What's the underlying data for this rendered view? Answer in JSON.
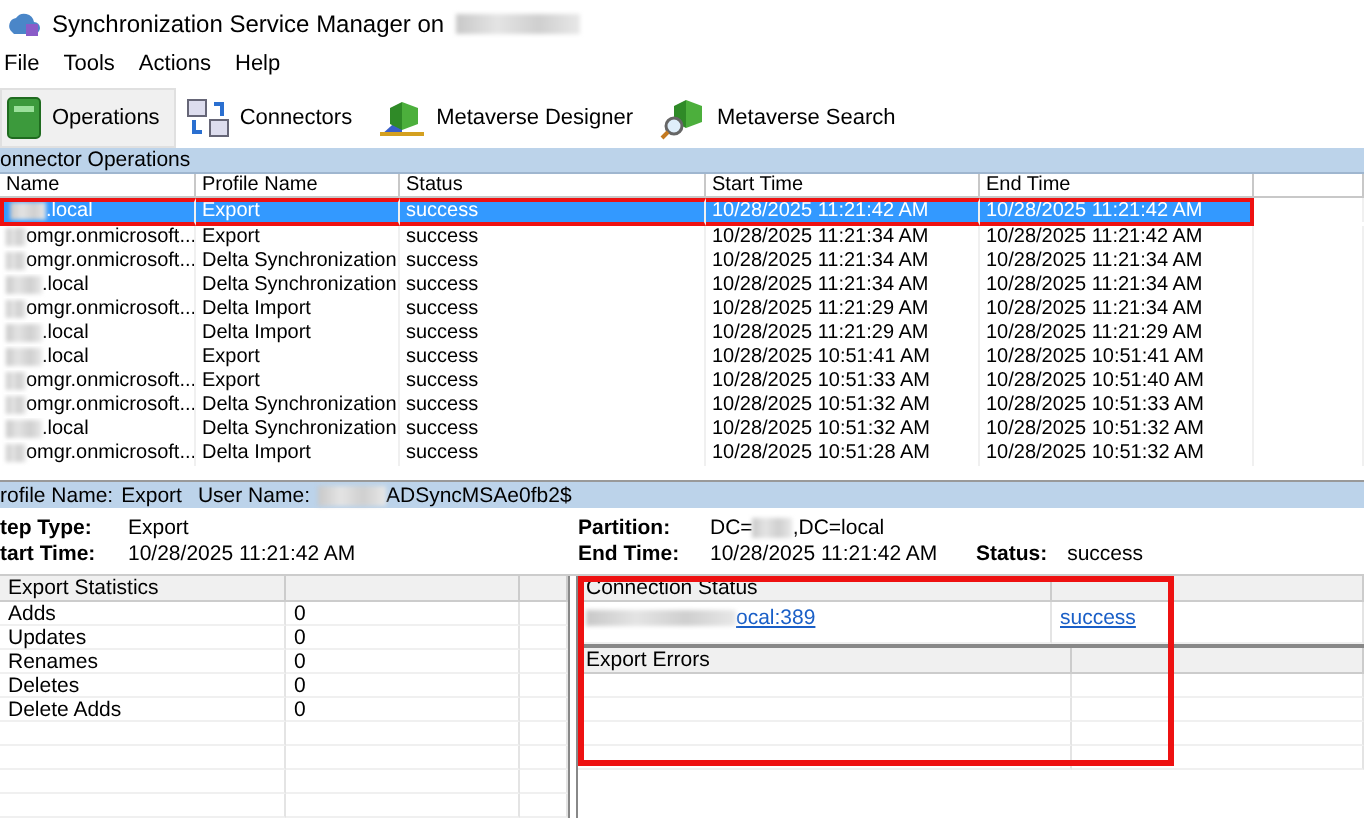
{
  "window": {
    "title": "Synchronization Service Manager on",
    "redacted": true
  },
  "menu": [
    "File",
    "Tools",
    "Actions",
    "Help"
  ],
  "toolbar": [
    {
      "label": "Operations",
      "kind": "operations",
      "selected": true
    },
    {
      "label": "Connectors",
      "kind": "connectors",
      "selected": false
    },
    {
      "label": "Metaverse Designer",
      "kind": "designer",
      "selected": false
    },
    {
      "label": "Metaverse Search",
      "kind": "search",
      "selected": false
    }
  ],
  "operations": {
    "title": "onnector Operations",
    "columns": [
      "Name",
      "Profile Name",
      "Status",
      "Start Time",
      "End Time"
    ],
    "rows": [
      {
        "name": ".local",
        "profile": "Export",
        "status": "success",
        "start": "10/28/2025 11:21:42 AM",
        "end": "10/28/2025 11:21:42 AM",
        "selected": true,
        "highlighted": true
      },
      {
        "name": "omgr.onmicrosoft...",
        "profile": "Export",
        "status": "success",
        "start": "10/28/2025 11:21:34 AM",
        "end": "10/28/2025 11:21:42 AM",
        "selected": false,
        "highlighted": false
      },
      {
        "name": "omgr.onmicrosoft...",
        "profile": "Delta Synchronization",
        "status": "success",
        "start": "10/28/2025 11:21:34 AM",
        "end": "10/28/2025 11:21:34 AM",
        "selected": false,
        "highlighted": false
      },
      {
        "name": ".local",
        "profile": "Delta Synchronization",
        "status": "success",
        "start": "10/28/2025 11:21:34 AM",
        "end": "10/28/2025 11:21:34 AM",
        "selected": false,
        "highlighted": false
      },
      {
        "name": "omgr.onmicrosoft...",
        "profile": "Delta Import",
        "status": "success",
        "start": "10/28/2025 11:21:29 AM",
        "end": "10/28/2025 11:21:34 AM",
        "selected": false,
        "highlighted": false
      },
      {
        "name": ".local",
        "profile": "Delta Import",
        "status": "success",
        "start": "10/28/2025 11:21:29 AM",
        "end": "10/28/2025 11:21:29 AM",
        "selected": false,
        "highlighted": false
      },
      {
        "name": ".local",
        "profile": "Export",
        "status": "success",
        "start": "10/28/2025 10:51:41 AM",
        "end": "10/28/2025 10:51:41 AM",
        "selected": false,
        "highlighted": false
      },
      {
        "name": "omgr.onmicrosoft...",
        "profile": "Export",
        "status": "success",
        "start": "10/28/2025 10:51:33 AM",
        "end": "10/28/2025 10:51:40 AM",
        "selected": false,
        "highlighted": false
      },
      {
        "name": "omgr.onmicrosoft...",
        "profile": "Delta Synchronization",
        "status": "success",
        "start": "10/28/2025 10:51:32 AM",
        "end": "10/28/2025 10:51:33 AM",
        "selected": false,
        "highlighted": false
      },
      {
        "name": ".local",
        "profile": "Delta Synchronization",
        "status": "success",
        "start": "10/28/2025 10:51:32 AM",
        "end": "10/28/2025 10:51:32 AM",
        "selected": false,
        "highlighted": false
      },
      {
        "name": "omgr.onmicrosoft...",
        "profile": "Delta Import",
        "status": "success",
        "start": "10/28/2025 10:51:28 AM",
        "end": "10/28/2025 10:51:32 AM",
        "selected": false,
        "highlighted": false
      }
    ]
  },
  "profile_bar": {
    "profile_label": "rofile Name:",
    "profile_value": "Export",
    "user_label": "User Name:",
    "user_value": "ADSyncMSAe0fb2$"
  },
  "details": {
    "step_type_label": "tep Type:",
    "step_type": "Export",
    "start_label": "tart Time:",
    "start": "10/28/2025 11:21:42 AM",
    "partition_label": "Partition:",
    "partition_prefix": "DC=",
    "partition_suffix": ",DC=local",
    "end_label": "End Time:",
    "end": "10/28/2025 11:21:42 AM",
    "status_label": "Status:",
    "status": "success"
  },
  "export_statistics": {
    "title": "Export Statistics",
    "rows": [
      {
        "label": "Adds",
        "value": "0"
      },
      {
        "label": "Updates",
        "value": "0"
      },
      {
        "label": "Renames",
        "value": "0"
      },
      {
        "label": "Deletes",
        "value": "0"
      },
      {
        "label": "Delete Adds",
        "value": "0"
      }
    ]
  },
  "connection_status": {
    "title": "Connection Status",
    "highlighted": true,
    "server": "ocal:389",
    "result": "success"
  },
  "export_errors": {
    "title": "Export Errors"
  }
}
